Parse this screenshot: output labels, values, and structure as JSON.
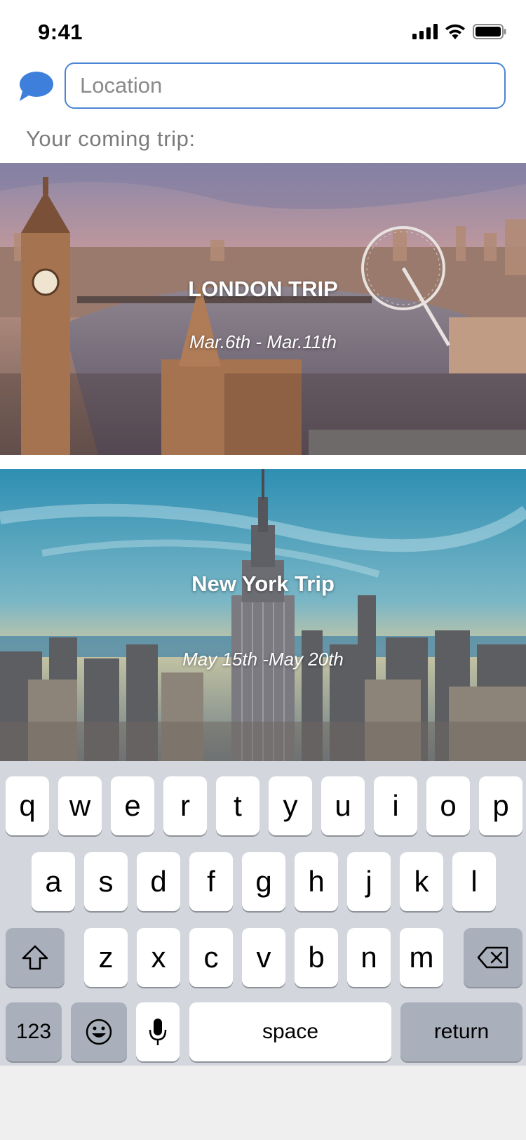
{
  "status_bar": {
    "time": "9:41",
    "icons": [
      "signal-icon",
      "wifi-icon",
      "battery-icon"
    ]
  },
  "header": {
    "chat_icon": "chat-bubble-icon",
    "search_placeholder": "Location",
    "search_value": ""
  },
  "section_label": "Your coming trip:",
  "trips": [
    {
      "title": "LONDON TRIP",
      "dates": "Mar.6th - Mar.11th",
      "image": "london-skyline-image"
    },
    {
      "title": "New York Trip",
      "dates": "May 15th -May 20th",
      "image": "new-york-skyline-image"
    }
  ],
  "keyboard": {
    "row1": [
      "q",
      "w",
      "e",
      "r",
      "t",
      "y",
      "u",
      "i",
      "o",
      "p"
    ],
    "row2": [
      "a",
      "s",
      "d",
      "f",
      "g",
      "h",
      "j",
      "k",
      "l"
    ],
    "row3": [
      "z",
      "x",
      "c",
      "v",
      "b",
      "n",
      "m"
    ],
    "shift_icon": "shift-arrow-icon",
    "delete_icon": "backspace-icon",
    "numbers_label": "123",
    "emoji_icon": "emoji-icon",
    "mic_icon": "microphone-icon",
    "space_label": "space",
    "return_label": "return"
  },
  "colors": {
    "accent": "#4a86d4",
    "keyboard_bg": "#d3d6dd",
    "dark_key": "#aab0bb"
  }
}
